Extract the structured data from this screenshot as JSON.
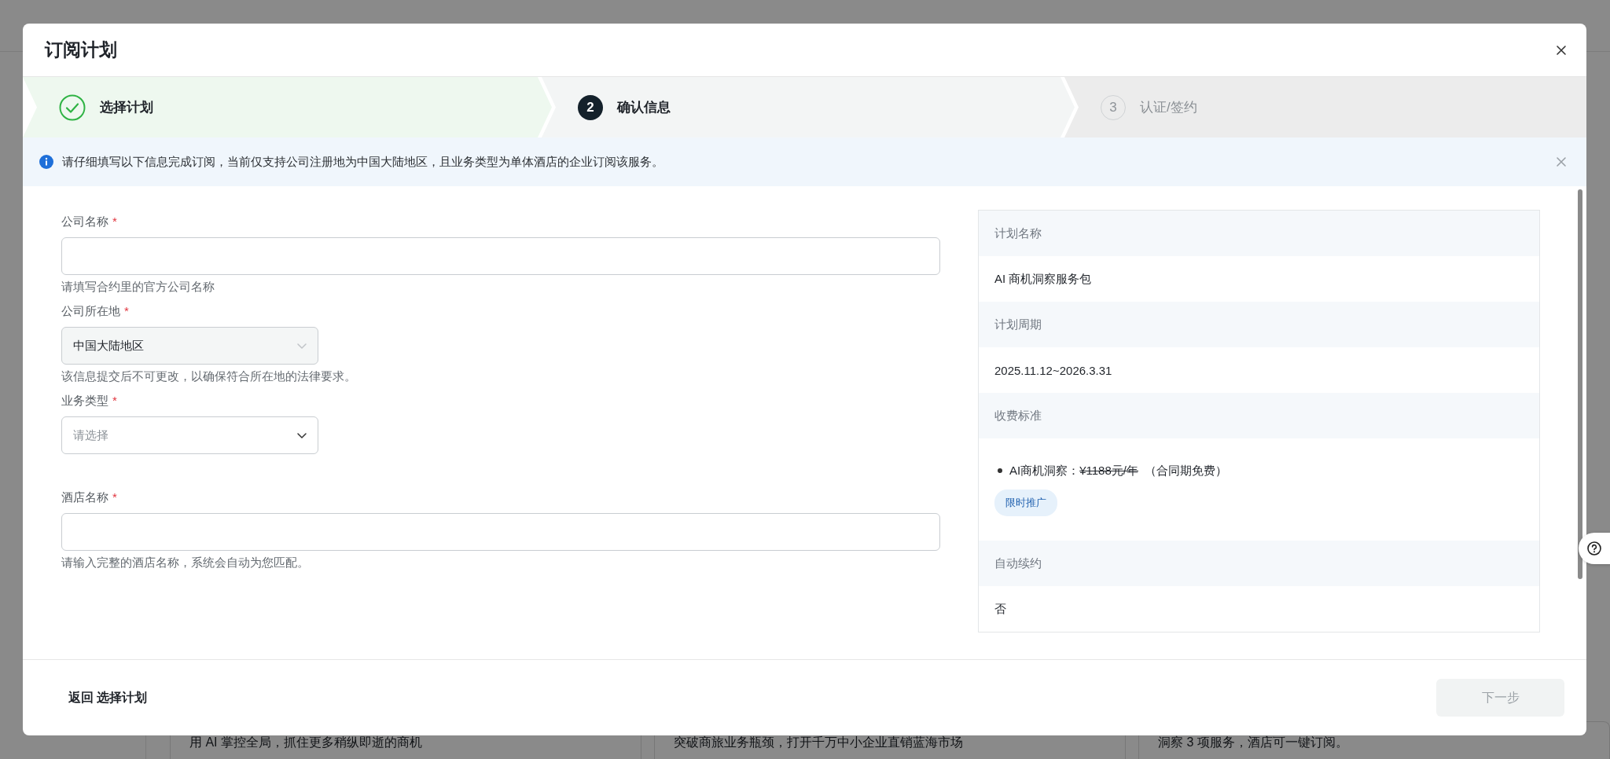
{
  "backdrop": {
    "cards": [
      {
        "text": "用 AI 掌控全局，抓住更多稍纵即逝的商机"
      },
      {
        "text": "突破商旅业务瓶颈，打开千万中小企业直销蓝海市场"
      },
      {
        "text": "洞察 3 项服务，酒店可一键订阅。"
      }
    ]
  },
  "dialog": {
    "title": "订阅计划",
    "steps": [
      {
        "label": "选择计划",
        "completed": true,
        "selected": false
      },
      {
        "number": "2",
        "label": "确认信息",
        "completed": false,
        "selected": true
      },
      {
        "number": "3",
        "label": "认证/签约",
        "completed": false,
        "selected": false
      }
    ],
    "alert": {
      "text": "请仔细填写以下信息完成订阅，当前仅支持公司注册地为中国大陆地区，且业务类型为单体酒店的企业订阅该服务。",
      "dismissible": true
    },
    "form": {
      "fields": [
        {
          "kind": "text",
          "label": "公司名称",
          "required_mark": "*",
          "help": "请填写合约里的官方公司名称"
        },
        {
          "kind": "select",
          "label": "公司所在地",
          "required_mark": "*",
          "value": "中国大陆地区",
          "disabled": true,
          "help": "该信息提交后不可更改，以确保符合所在地的法律要求。"
        },
        {
          "kind": "select",
          "label": "业务类型",
          "required_mark": "*",
          "placeholder": "请选择",
          "disabled": false
        },
        {
          "kind": "text",
          "label": "酒店名称",
          "required_mark": "*",
          "help": "请输入完整的酒店名称，系统会自动为您匹配。"
        }
      ]
    },
    "summary": {
      "rows": [
        {
          "label": "计划名称",
          "kind": "text",
          "value": "AI 商机洞察服务包"
        },
        {
          "label": "计划周期",
          "kind": "text",
          "value": "2025.11.12~2026.3.31"
        },
        {
          "label": "收费标准",
          "kind": "price",
          "items": [
            {
              "name": "AI商机洞察：",
              "old_price": "¥1188元/年",
              "note": "（合同期免费）"
            }
          ],
          "tag": "限时推广"
        },
        {
          "label": "自动续约",
          "kind": "text",
          "value": "否"
        }
      ]
    },
    "footer": {
      "back_link": "返回 选择计划",
      "next_button": {
        "label": "下一步",
        "disabled": true
      }
    }
  }
}
